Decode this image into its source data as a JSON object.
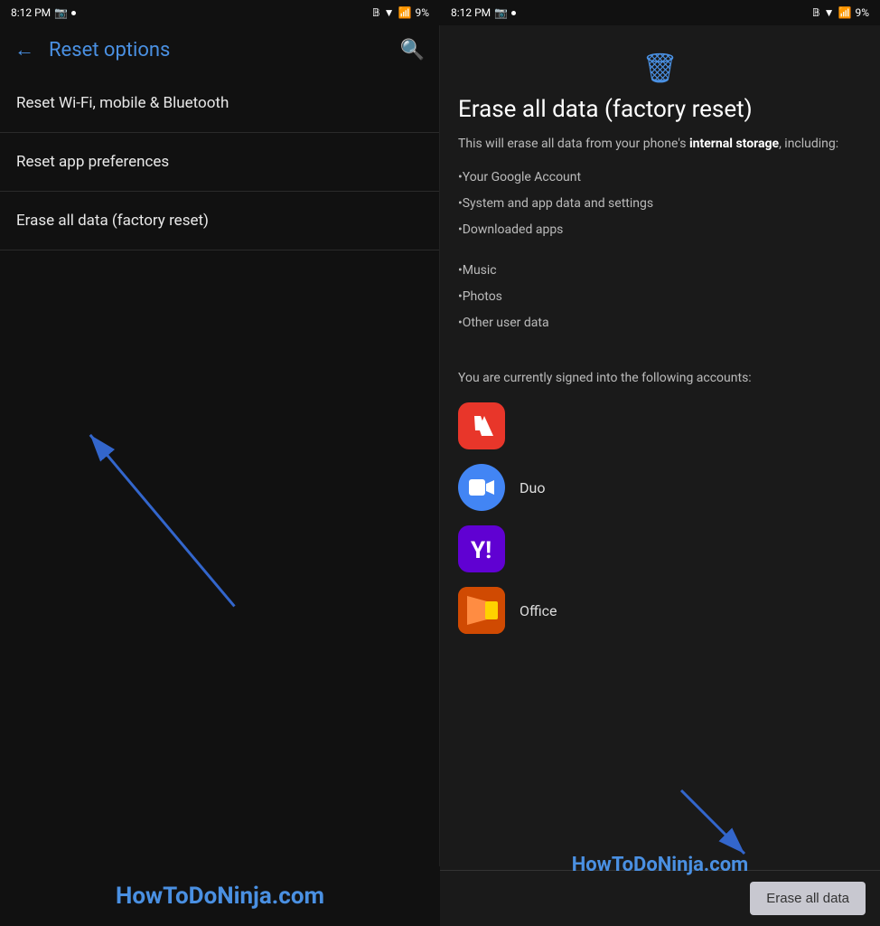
{
  "status_bar": {
    "left": {
      "time": "8:12 PM",
      "dot": true
    },
    "right": {
      "time": "8:12 PM",
      "dot": true,
      "battery": "9%"
    }
  },
  "left_panel": {
    "back_label": "←",
    "title": "Reset options",
    "search_icon": "🔍",
    "menu_items": [
      {
        "label": "Reset Wi-Fi, mobile & Bluetooth"
      },
      {
        "label": "Reset app preferences"
      },
      {
        "label": "Erase all data (factory reset)"
      }
    ]
  },
  "right_panel": {
    "title": "Erase all data (factory reset)",
    "description_start": "This will erase all data from your phone's ",
    "description_bold": "internal storage",
    "description_end": ", including:",
    "bullets": [
      "•Your Google Account",
      "•System and app data and settings",
      "•Downloaded apps",
      "•Music",
      "•Photos",
      "•Other user data"
    ],
    "signed_in_text": "You are currently signed into the following accounts:",
    "accounts": [
      {
        "name": "Adobe",
        "type": "adobe",
        "label": ""
      },
      {
        "name": "Duo",
        "type": "duo",
        "label": "Duo"
      },
      {
        "name": "Yahoo",
        "type": "yahoo",
        "label": ""
      },
      {
        "name": "Office",
        "type": "office",
        "label": "Office"
      }
    ],
    "erase_button_label": "Erase all data"
  },
  "watermark": {
    "text": "HowToDoNinja.com"
  }
}
